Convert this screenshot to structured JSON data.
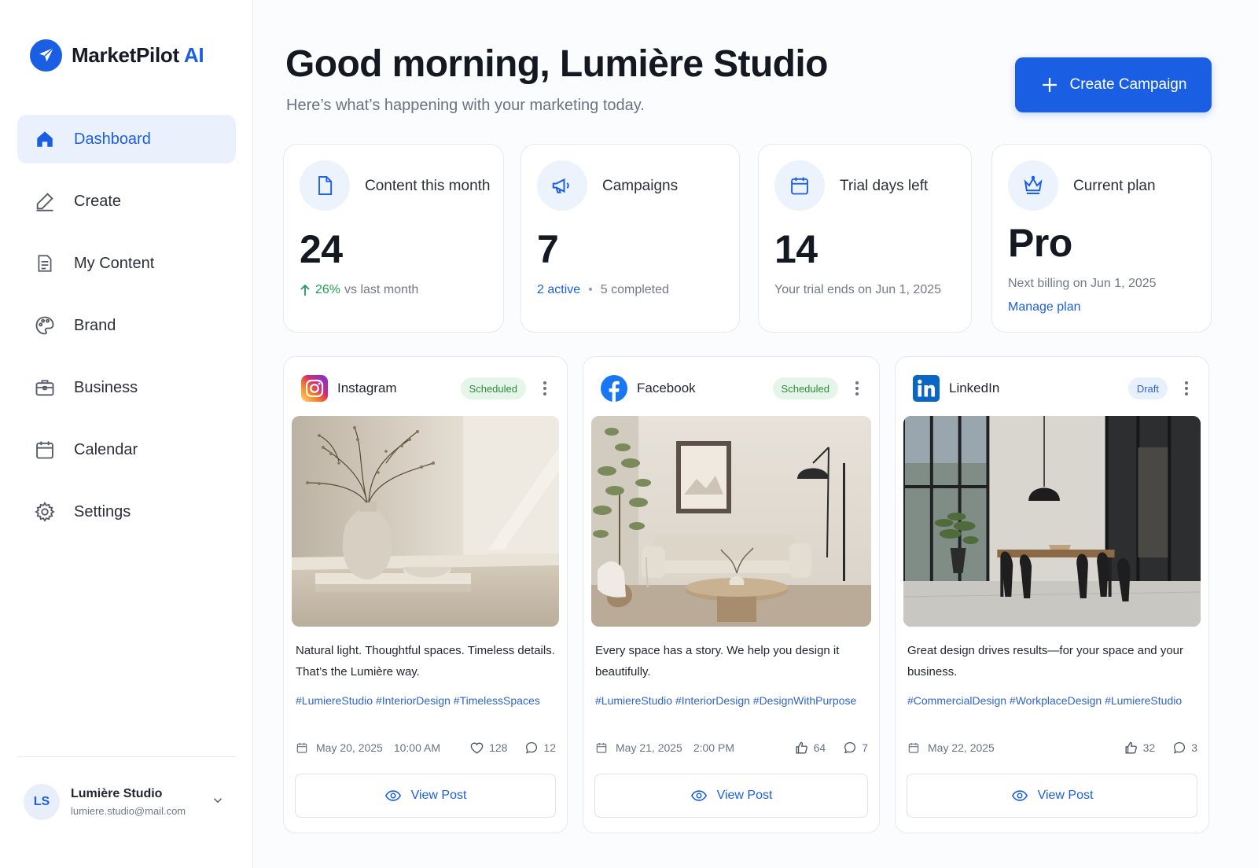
{
  "brand": {
    "name": "MarketPilot",
    "ai": "AI"
  },
  "nav": {
    "items": [
      {
        "label": "Dashboard",
        "icon": "home-icon",
        "active": true
      },
      {
        "label": "Create",
        "icon": "pencil-icon"
      },
      {
        "label": "My Content",
        "icon": "document-icon"
      },
      {
        "label": "Brand",
        "icon": "palette-icon"
      },
      {
        "label": "Business",
        "icon": "briefcase-icon"
      },
      {
        "label": "Calendar",
        "icon": "calendar-icon"
      },
      {
        "label": "Settings",
        "icon": "gear-icon"
      }
    ]
  },
  "user": {
    "initials": "LS",
    "name": "Lumière Studio",
    "email": "lumiere.studio@mail.com"
  },
  "header": {
    "greeting": "Good morning, Lumière Studio",
    "subtitle": "Here’s what’s happening with your marketing today.",
    "create_label": "Create Campaign"
  },
  "stats": {
    "content": {
      "label": "Content this month",
      "value": "24",
      "change": "26%",
      "change_suffix": "vs last month"
    },
    "campaigns": {
      "label": "Campaigns",
      "value": "7",
      "active": "2 active",
      "completed": "5 completed"
    },
    "trial": {
      "label": "Trial days left",
      "value": "14",
      "note": "Your trial ends on Jun 1, 2025"
    },
    "plan": {
      "label": "Current plan",
      "value": "Pro",
      "billing": "Next billing on Jun 1, 2025",
      "manage": "Manage plan"
    }
  },
  "posts": [
    {
      "platform": "Instagram",
      "status": "Scheduled",
      "caption": "Natural light. Thoughtful spaces. Timeless details. That’s the Lumière way.",
      "tags": "#LumiereStudio #InteriorDesign #TimelessSpaces",
      "date": "May 20, 2025",
      "time": "10:00 AM",
      "likes": "128",
      "comments": "12",
      "view": "View Post"
    },
    {
      "platform": "Facebook",
      "status": "Scheduled",
      "caption": "Every space has a story. We help you design it beautifully.",
      "tags": "#LumiereStudio #InteriorDesign #DesignWithPurpose",
      "date": "May 21, 2025",
      "time": "2:00 PM",
      "likes": "64",
      "comments": "7",
      "view": "View Post"
    },
    {
      "platform": "LinkedIn",
      "status": "Draft",
      "caption": "Great design drives results—for your space and your business.",
      "tags": "#CommercialDesign #WorkplaceDesign #LumiereStudio",
      "date": "May 22, 2025",
      "time": "",
      "likes": "32",
      "comments": "3",
      "view": "View Post"
    }
  ],
  "colors": {
    "accent": "#1a5fe3",
    "success": "#1f9d55",
    "scheduled_bg": "#e6f5e9",
    "draft_bg": "#e8f0fd"
  }
}
